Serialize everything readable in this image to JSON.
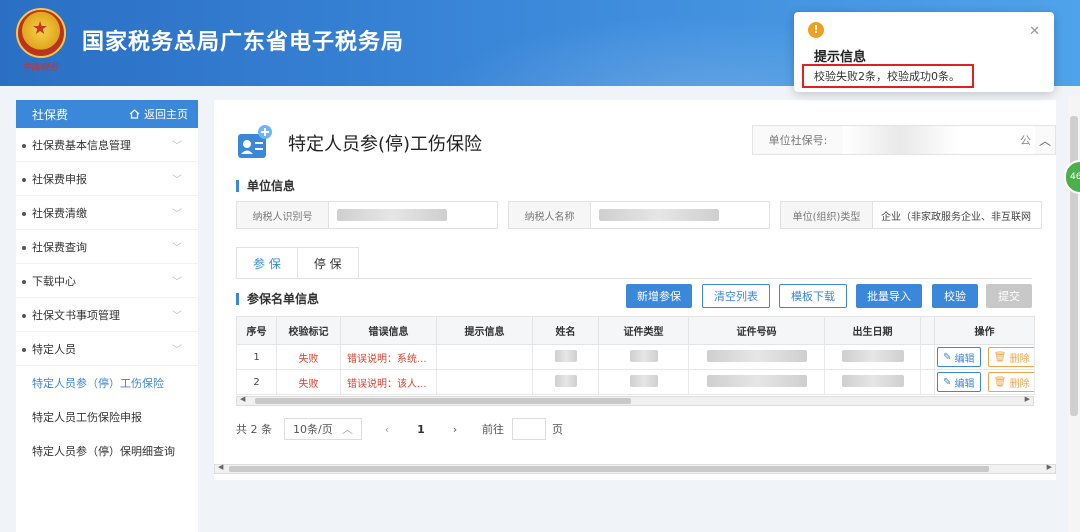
{
  "header": {
    "title": "国家税务总局广东省电子税务局",
    "seal_text": "中国税务"
  },
  "sidebar": {
    "title": "社保费",
    "home_link": "返回主页",
    "items": [
      {
        "label": "社保费基本信息管理"
      },
      {
        "label": "社保费申报"
      },
      {
        "label": "社保费清缴"
      },
      {
        "label": "社保费查询"
      },
      {
        "label": "下载中心"
      },
      {
        "label": "社保文书事项管理"
      },
      {
        "label": "特定人员"
      }
    ],
    "subitems": [
      {
        "label": "特定人员参（停）工伤保险",
        "active": true
      },
      {
        "label": "特定人员工伤保险申报",
        "active": false
      },
      {
        "label": "特定人员参（停）保明细查询",
        "active": false
      }
    ]
  },
  "main": {
    "page_title": "特定人员参(停)工伤保险",
    "unit_social_no_label": "单位社保号:",
    "unit_social_no_value": "公",
    "unit_info_title": "单位信息",
    "taxpayer_id_label": "纳税人识别号",
    "taxpayer_name_label": "纳税人名称",
    "unit_type_label": "单位(组织)类型",
    "unit_type_value": "企业（非家政服务企业、非互联网",
    "tabs": [
      {
        "label": "参 保"
      },
      {
        "label": "停 保"
      }
    ],
    "roster_title": "参保名单信息",
    "buttons": {
      "add": "新增参保",
      "clear": "清空列表",
      "template": "模板下载",
      "import": "批量导入",
      "verify": "校验",
      "submit": "提交"
    },
    "table": {
      "columns": [
        "序号",
        "校验标记",
        "错误信息",
        "提示信息",
        "姓名",
        "证件类型",
        "证件号码",
        "出生日期",
        "",
        "操作"
      ],
      "rows": [
        {
          "no": "1",
          "flag": "失败",
          "error": "错误说明：系统...",
          "hint": ""
        },
        {
          "no": "2",
          "flag": "失败",
          "error": "错误说明：该人...",
          "hint": ""
        }
      ],
      "edit_label": "编辑",
      "delete_label": "删除"
    },
    "pager": {
      "total": "共 2 条",
      "page_size": "10条/页",
      "current": "1",
      "goto_label": "前往",
      "page_suffix": "页"
    }
  },
  "toast": {
    "title": "提示信息",
    "message": "校验失败2条，校验成功0条。"
  },
  "side_badge": "46",
  "colors": {
    "primary": "#3b87d9",
    "fail": "#e0412f",
    "warning": "#f0a020",
    "highlight_border": "#e02020"
  }
}
